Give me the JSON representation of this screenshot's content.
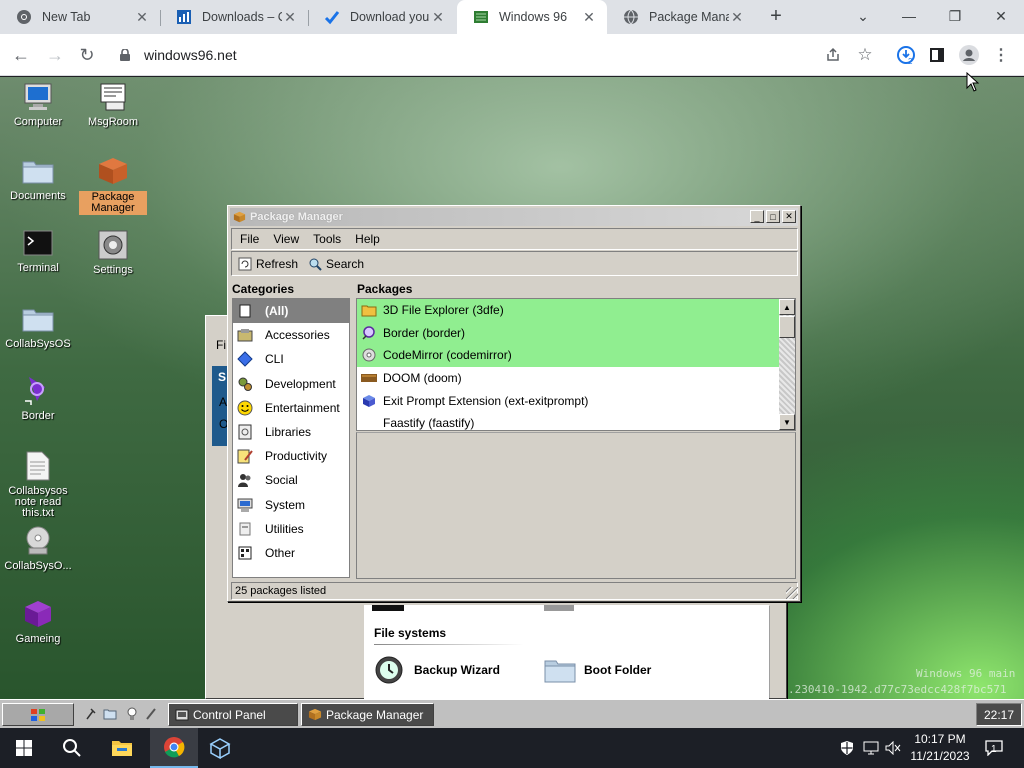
{
  "browser": {
    "tabs": [
      {
        "title": "New Tab",
        "icon": "chrome-icon"
      },
      {
        "title": "Downloads – C",
        "icon": "downloads-icon"
      },
      {
        "title": "Download your",
        "icon": "checkmark-icon"
      },
      {
        "title": "Windows 96",
        "icon": "windows96-icon",
        "active": true
      },
      {
        "title": "Package Manag",
        "icon": "globe-icon"
      }
    ],
    "url": "windows96.net",
    "download_badge": "2"
  },
  "desktop": {
    "icons": [
      {
        "label": "Computer"
      },
      {
        "label": "MsgRoom"
      },
      {
        "label": "Documents"
      },
      {
        "label": "Package Manager",
        "selected": true
      },
      {
        "label": "Terminal"
      },
      {
        "label": "Settings"
      },
      {
        "label": "CollabSysOS"
      },
      {
        "label": "Border"
      },
      {
        "label": "Collabsysos note read this.txt"
      },
      {
        "label": "CollabSysO..."
      },
      {
        "label": "Gameing"
      }
    ],
    "watermark_line1": "Windows 96 main",
    "watermark_line2": ".230410-1942.d77c73edcc428f7bc571"
  },
  "control_panel": {
    "menu_fragment": "Fi",
    "left_fragment1": "S",
    "left_fragment2": "A",
    "left_fragment3": "O",
    "section": "File systems",
    "items": [
      "Backup Wizard",
      "Boot Folder"
    ]
  },
  "package_manager": {
    "title": "Package Manager",
    "menu": [
      "File",
      "View",
      "Tools",
      "Help"
    ],
    "toolbar": {
      "refresh": "Refresh",
      "search": "Search"
    },
    "categories_header": "Categories",
    "packages_header": "Packages",
    "categories": [
      {
        "label": "(All)",
        "active": true
      },
      {
        "label": "Accessories"
      },
      {
        "label": "CLI"
      },
      {
        "label": "Development"
      },
      {
        "label": "Entertainment"
      },
      {
        "label": "Libraries"
      },
      {
        "label": "Productivity"
      },
      {
        "label": "Social"
      },
      {
        "label": "System"
      },
      {
        "label": "Utilities"
      },
      {
        "label": "Other"
      }
    ],
    "packages": [
      {
        "label": "3D File Explorer (3dfe)",
        "installed": true
      },
      {
        "label": "Border (border)",
        "installed": true
      },
      {
        "label": "CodeMirror (codemirror)",
        "installed": true
      },
      {
        "label": "DOOM (doom)",
        "installed": false
      },
      {
        "label": "Exit Prompt Extension (ext-exitprompt)",
        "installed": false
      },
      {
        "label": "Faastify (faastify)",
        "installed": false
      }
    ],
    "status": "25 packages listed"
  },
  "w96_taskbar": {
    "buttons": [
      "Control Panel",
      "Package Manager"
    ],
    "clock": "22:17"
  },
  "win_taskbar": {
    "time": "10:17 PM",
    "date": "11/21/2023",
    "notification_count": "1"
  },
  "colors": {
    "installed_highlight": "#90ee90",
    "selected_category": "#808080",
    "desktop_selection": "#e8a060"
  }
}
